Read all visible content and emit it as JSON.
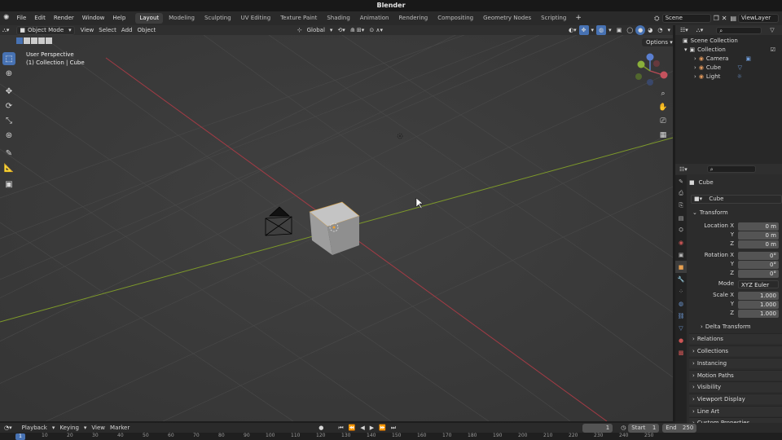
{
  "window": {
    "title": "Blender"
  },
  "menu": [
    "File",
    "Edit",
    "Render",
    "Window",
    "Help"
  ],
  "workspaces": [
    "Layout",
    "Modeling",
    "Sculpting",
    "UV Editing",
    "Texture Paint",
    "Shading",
    "Animation",
    "Rendering",
    "Compositing",
    "Geometry Nodes",
    "Scripting"
  ],
  "active_workspace": "Layout",
  "scene": {
    "label": "Scene",
    "viewlayer": "ViewLayer"
  },
  "viewport_header": {
    "mode": "Object Mode",
    "menus": [
      "View",
      "Select",
      "Add",
      "Object"
    ],
    "orientation": "Global",
    "options": "Options"
  },
  "viewport": {
    "info_line1": "User Perspective",
    "info_line2": "(1) Collection | Cube"
  },
  "outliner": {
    "root": "Scene Collection",
    "collection": "Collection",
    "items": [
      "Camera",
      "Cube",
      "Light"
    ]
  },
  "properties": {
    "object_name": "Cube",
    "data_name": "Cube",
    "transform_title": "Transform",
    "location": {
      "label_x": "Location X",
      "label_y": "Y",
      "label_z": "Z",
      "x": "0 m",
      "y": "0 m",
      "z": "0 m"
    },
    "rotation": {
      "label_x": "Rotation X",
      "label_y": "Y",
      "label_z": "Z",
      "x": "0°",
      "y": "0°",
      "z": "0°"
    },
    "mode": {
      "label": "Mode",
      "value": "XYZ Euler"
    },
    "scale": {
      "label_x": "Scale X",
      "label_y": "Y",
      "label_z": "Z",
      "x": "1.000",
      "y": "1.000",
      "z": "1.000"
    },
    "delta": "Delta Transform",
    "panels": [
      "Relations",
      "Collections",
      "Instancing",
      "Motion Paths",
      "Visibility",
      "Viewport Display",
      "Line Art",
      "Custom Properties"
    ]
  },
  "timeline": {
    "menus": [
      "Playback",
      "Keying",
      "View",
      "Marker"
    ],
    "current_frame": "1",
    "start_label": "Start",
    "start": "1",
    "end_label": "End",
    "end": "250",
    "ticks": [
      "1",
      "10",
      "20",
      "30",
      "40",
      "50",
      "60",
      "70",
      "80",
      "90",
      "100",
      "110",
      "120",
      "130",
      "140",
      "150",
      "160",
      "170",
      "180",
      "190",
      "200",
      "210",
      "220",
      "230",
      "240",
      "250"
    ]
  },
  "colors": {
    "accent": "#4772b3",
    "x_axis": "#a33b45",
    "y_axis": "#7e9a2a"
  }
}
